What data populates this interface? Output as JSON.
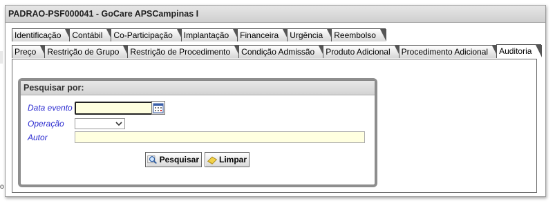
{
  "window": {
    "title": "PADRAO-PSF000041 - GoCare APSCampinas I"
  },
  "tabs_row1": [
    {
      "label": "Identificação"
    },
    {
      "label": "Contábil"
    },
    {
      "label": "Co-Participação"
    },
    {
      "label": "Implantação"
    },
    {
      "label": "Financeira"
    },
    {
      "label": "Urgência"
    },
    {
      "label": "Reembolso"
    }
  ],
  "tabs_row2": [
    {
      "label": "Preço"
    },
    {
      "label": "Restrição de Grupo"
    },
    {
      "label": "Restrição de Procedimento"
    },
    {
      "label": "Condição Admissão"
    },
    {
      "label": "Produto Adicional"
    },
    {
      "label": "Procedimento Adicional"
    },
    {
      "label": "Auditoria",
      "active": true
    }
  ],
  "search_panel": {
    "title": "Pesquisar por:",
    "fields": {
      "data_evento": {
        "label": "Data evento",
        "value": ""
      },
      "operacao": {
        "label": "Operação",
        "selected": ""
      },
      "autor": {
        "label": "Autor",
        "value": ""
      }
    },
    "buttons": {
      "search_label": "Pesquisar",
      "clear_label": "Limpar"
    }
  },
  "colors": {
    "field_label": "#2a2ad0",
    "input_background": "#ffffe0"
  },
  "misc": {
    "stray_char": "o"
  }
}
